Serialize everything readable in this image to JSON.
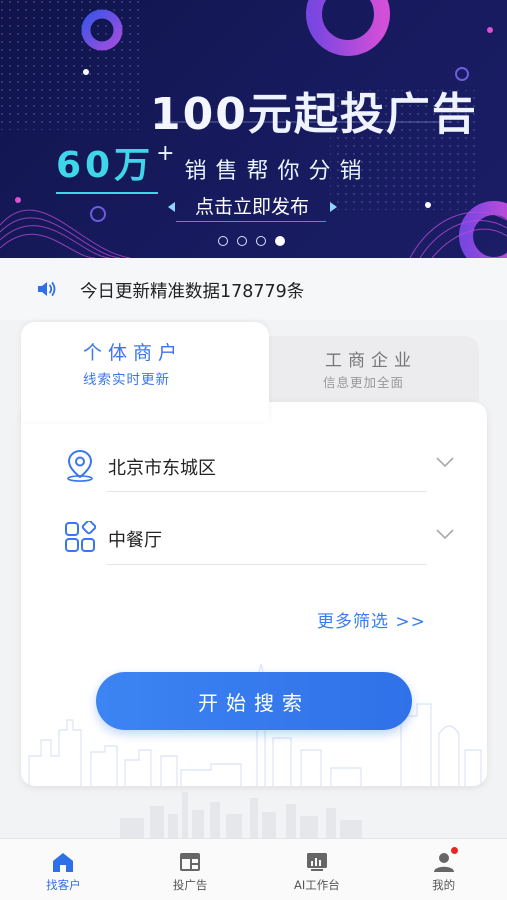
{
  "banner": {
    "headline_num": "100",
    "headline_text": "元起投广告",
    "big_num": "60万",
    "plus": "+",
    "sub": "销售帮你分销",
    "publish_label": "点击立即发布",
    "indicator_count": 4,
    "active_indicator": 4
  },
  "notice": {
    "text": "今日更新精准数据178779条"
  },
  "tabs": [
    {
      "title": "个体商户",
      "subtitle": "线索实时更新",
      "active": true
    },
    {
      "title": "工商企业",
      "subtitle": "信息更加全面",
      "active": false
    }
  ],
  "form": {
    "location": "北京市东城区",
    "category": "中餐厅",
    "more_filters": "更多筛选 >>",
    "search_button": "开始搜索"
  },
  "nav": [
    {
      "label": "找客户",
      "icon": "home-icon",
      "active": true
    },
    {
      "label": "投广告",
      "icon": "ad-icon",
      "active": false
    },
    {
      "label": "AI工作台",
      "icon": "dashboard-icon",
      "active": false
    },
    {
      "label": "我的",
      "icon": "user-icon",
      "active": false,
      "badge": true
    }
  ],
  "colors": {
    "primary": "#2f6fe8",
    "banner_bg": "#141859",
    "accent_cyan": "#3fd6e9",
    "badge": "#e8261f"
  }
}
